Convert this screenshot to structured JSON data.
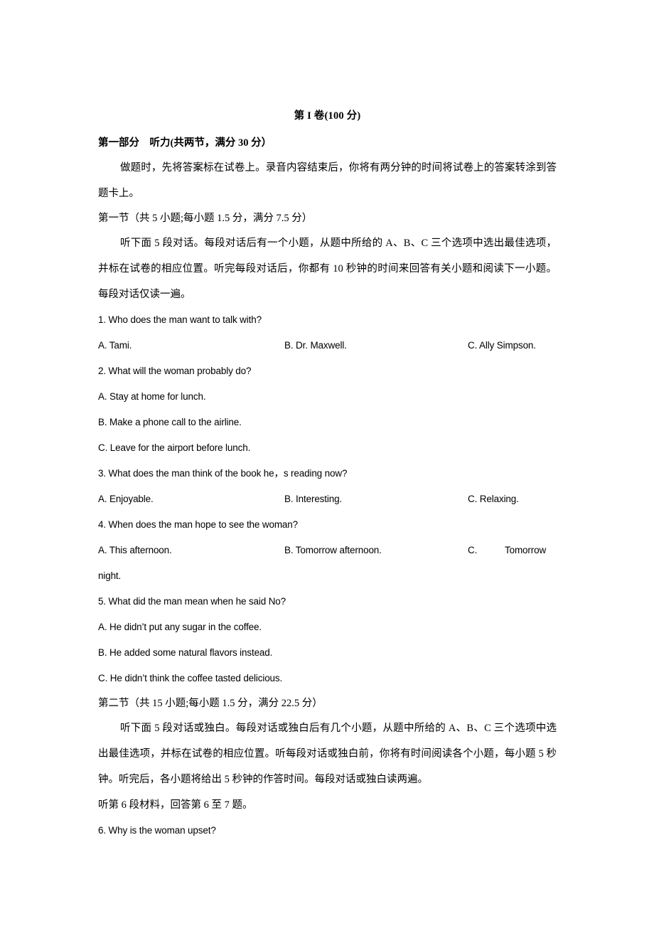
{
  "document": {
    "title": "第 I 卷(100 分)",
    "part_one_heading": "第一部分    听力(共两节，满分 30 分）",
    "part_one_intro": "做题时，先将答案标在试卷上。录音内容结束后，你将有两分钟的时间将试卷上的答案转涂到答题卡上。",
    "section_one": {
      "heading": "第一节（共 5 小题;每小题 1.5 分，满分 7.5 分）",
      "instruction": "听下面 5 段对话。每段对话后有一个小题，从题中所给的 A、B、C 三个选项中选出最佳选项，并标在试卷的相应位置。听完每段对话后，你都有 10 秒钟的时间来回答有关小题和阅读下一小题。每段对话仅读一遍。"
    },
    "section_two": {
      "heading": "第二节（共 15 小题;每小题 1.5 分，满分 22.5 分）",
      "instruction": "听下面 5 段对话或独白。每段对话或独白后有几个小题，从题中所给的 A、B、C 三个选项中选出最佳选项，并标在试卷的相应位置。听每段对话或独白前，你将有时间阅读各个小题，每小题 5 秒钟。听完后，各小题将给出 5 秒钟的作答时间。每段对话或独白读两遍。",
      "material_note": "听第 6 段材料，回答第 6 至 7 题。"
    },
    "questions": [
      {
        "number": "1",
        "stem": "1. Who does the man want to talk with?",
        "layout": "inline",
        "options": [
          "A. Tami.",
          "B. Dr. Maxwell.",
          "C. Ally Simpson."
        ]
      },
      {
        "number": "2",
        "stem": "2. What will the woman probably do?",
        "layout": "stacked",
        "options": [
          "A. Stay at home for lunch.",
          "B. Make a phone call to the airline.",
          "C. Leave for the airport before lunch."
        ]
      },
      {
        "number": "3",
        "stem": "3. What does the man think of the book he，s reading now?",
        "layout": "inline",
        "options": [
          "A. Enjoyable.",
          "B. Interesting.",
          "C. Relaxing."
        ]
      },
      {
        "number": "4",
        "stem": "4. When does the man hope to see the woman?",
        "layout": "inline-split",
        "options": [
          "A. This afternoon.",
          "B. Tomorrow afternoon."
        ],
        "option_c_mark": "C.",
        "option_c_text": "Tomorrow",
        "option_c_wrap": "night."
      },
      {
        "number": "5",
        "stem": "5. What did the man mean when he said No?",
        "layout": "stacked",
        "options": [
          "A. He didn’t put any sugar in the coffee.",
          "B. He added some natural flavors instead.",
          "C. He didn’t think the coffee tasted delicious."
        ]
      },
      {
        "number": "6",
        "stem": "6. Why is the woman upset?",
        "layout": "stem-only",
        "options": []
      }
    ]
  }
}
